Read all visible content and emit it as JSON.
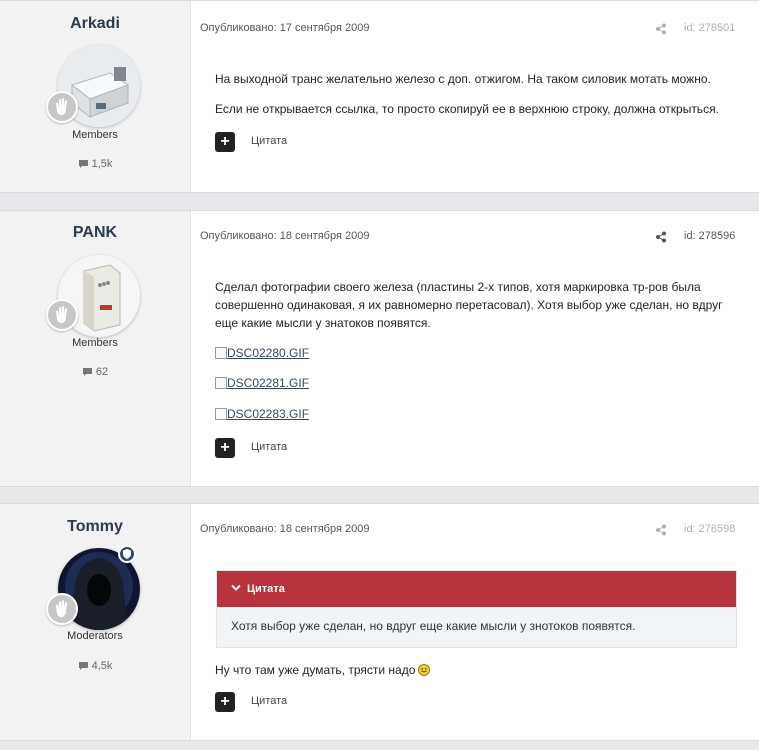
{
  "posts": [
    {
      "author": "Arkadi",
      "group": "Members",
      "post_count": "1,5k",
      "published": "Опубликовано: 17 сентября 2009",
      "post_id": "id: 278501",
      "body": [
        "На выходной транс желательно железо с доп. отжигом. На таком силовик мотать можно.",
        "Если не открывается ссылка, то просто скопируй ее в верхнюю строку, должна открыться."
      ],
      "quote_label": "Цитата"
    },
    {
      "author": "PANK",
      "group": "Members",
      "post_count": "62",
      "published": "Опубликовано: 18 сентября 2009",
      "post_id": "id: 278596",
      "body": [
        "Сделал фотографии своего железа (пластины 2-х типов, хотя маркировка тр-ров была",
        "совершенно одинаковая, я их равномерно перетасовал). Хотя выбор уже сделан, но вдруг",
        "еще какие мысли у знатоков появятся."
      ],
      "images": [
        "DSC02280.GIF",
        "DSC02281.GIF",
        "DSC02283.GIF"
      ],
      "quote_label": "Цитата"
    },
    {
      "author": "Tommy",
      "group": "Moderators",
      "post_count": "4,5k",
      "published": "Опубликовано: 18 сентября 2009",
      "post_id": "id: 278598",
      "quote": {
        "title": "Цитата",
        "text": "Хотя выбор уже сделан, но вдруг еще какие мысли у знотоков появятся."
      },
      "body": [
        "Ну что там уже думать, трясти надо"
      ],
      "quote_label": "Цитата"
    }
  ],
  "colors": {
    "quote_header": "#b8333b",
    "author_panel": "#f2f2f3",
    "moderator_badge": "#2d4b73"
  },
  "icons": [
    "share-icon",
    "comment-icon",
    "plus-icon",
    "chevron-down-icon",
    "rank-hand-icon",
    "shield-icon",
    "smiley-icon",
    "broken-image-icon"
  ]
}
